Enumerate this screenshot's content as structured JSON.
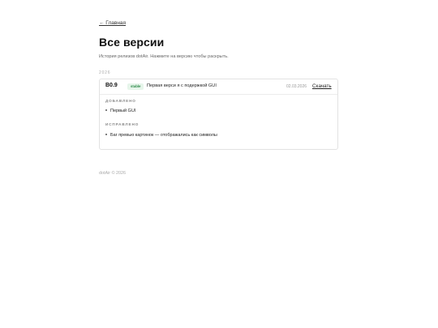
{
  "nav": {
    "back_label": "← Главная"
  },
  "header": {
    "title": "Все версии",
    "subtitle": "История релизов dotAir. Нажмите на версию чтобы раскрыть."
  },
  "groups": [
    {
      "year": "2026",
      "releases": [
        {
          "version": "B0.9",
          "badge": "stable",
          "summary": "Первая верси я с подержкой GUI",
          "date": "02.03.2026",
          "download_label": "Скачать",
          "sections": [
            {
              "label": "ДОБАВЛЕНО",
              "items": [
                "Первый GUI"
              ]
            },
            {
              "label": "ИСПРАВЛЕНО",
              "items": [
                "Баг превью картинок — отображались как символы"
              ]
            }
          ]
        }
      ]
    }
  ],
  "footer": {
    "text": "dotAir © 2026"
  },
  "colors": {
    "badge_text": "#2e8a4a",
    "badge_bg": "#e6f5ea",
    "border": "#e2e2e2"
  }
}
